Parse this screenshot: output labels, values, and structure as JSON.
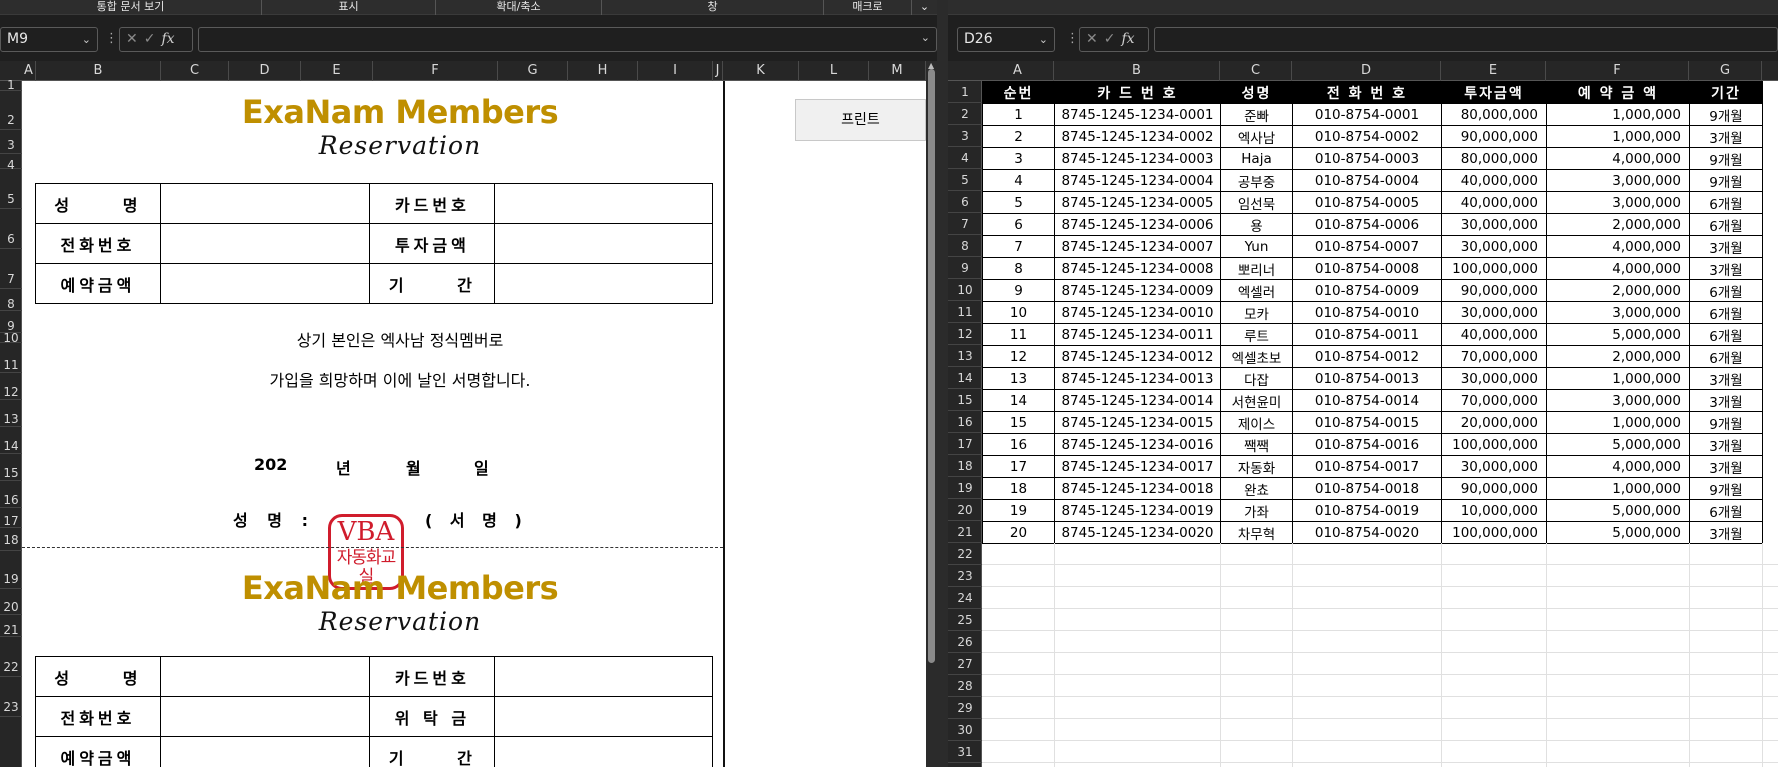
{
  "left": {
    "menu": [
      "통합 문서 보기",
      "표시",
      "확대/축소",
      "창",
      "매크로"
    ],
    "name_box": "M9",
    "columns": [
      "A",
      "B",
      "C",
      "D",
      "E",
      "F",
      "G",
      "H",
      "I",
      "J",
      "K",
      "L",
      "M"
    ],
    "rows": [
      "1",
      "2",
      "3",
      "4",
      "5",
      "6",
      "7",
      "8",
      "9",
      "10",
      "11",
      "12",
      "13",
      "14",
      "15",
      "16",
      "17",
      "18",
      "19",
      "20",
      "21",
      "22",
      "23"
    ],
    "print_button": "프린트",
    "form1": {
      "title": "ExaNam Members",
      "subtitle": "Reservation",
      "labels": {
        "name": "성 명",
        "card": "카드번호",
        "phone": "전화번호",
        "invest": "투자금액",
        "reserve": "예약금액",
        "period": "기 간"
      },
      "statement1": "상기 본인은 엑사남 정식멤버로",
      "statement2": "가입을 희망하며 이에 날인 서명합니다.",
      "date": {
        "year": "202",
        "year_unit": "년",
        "month": "월",
        "day": "일"
      },
      "sign_label": "성 명 :",
      "sign_tail": "( 서 명 )"
    },
    "stamp": {
      "top": "VBA",
      "bottom": "자동화교실"
    },
    "form2": {
      "title": "ExaNam Members",
      "subtitle": "Reservation",
      "labels": {
        "name": "성 명",
        "card": "카드번호",
        "phone": "전화번호",
        "deposit": "위 탁 금",
        "reserve": "예약금액",
        "period": "기 간"
      }
    }
  },
  "right": {
    "name_box": "D26",
    "columns": [
      "A",
      "B",
      "C",
      "D",
      "E",
      "F",
      "G"
    ],
    "headers": [
      "순번",
      "카 드 번 호",
      "성명",
      "전 화 번 호",
      "투자금액",
      "예 약 금 액",
      "기간"
    ],
    "rows": [
      [
        "1",
        "8745-1245-1234-0001",
        "준빠",
        "010-8754-0001",
        "80,000,000",
        "1,000,000",
        "9개월"
      ],
      [
        "2",
        "8745-1245-1234-0002",
        "엑사남",
        "010-8754-0002",
        "90,000,000",
        "1,000,000",
        "3개월"
      ],
      [
        "3",
        "8745-1245-1234-0003",
        "Haja",
        "010-8754-0003",
        "80,000,000",
        "4,000,000",
        "9개월"
      ],
      [
        "4",
        "8745-1245-1234-0004",
        "공부중",
        "010-8754-0004",
        "40,000,000",
        "3,000,000",
        "9개월"
      ],
      [
        "5",
        "8745-1245-1234-0005",
        "임선묵",
        "010-8754-0005",
        "40,000,000",
        "3,000,000",
        "6개월"
      ],
      [
        "6",
        "8745-1245-1234-0006",
        "용",
        "010-8754-0006",
        "30,000,000",
        "2,000,000",
        "6개월"
      ],
      [
        "7",
        "8745-1245-1234-0007",
        "Yun",
        "010-8754-0007",
        "30,000,000",
        "4,000,000",
        "3개월"
      ],
      [
        "8",
        "8745-1245-1234-0008",
        "뽀리너",
        "010-8754-0008",
        "100,000,000",
        "4,000,000",
        "3개월"
      ],
      [
        "9",
        "8745-1245-1234-0009",
        "엑셀러",
        "010-8754-0009",
        "90,000,000",
        "2,000,000",
        "6개월"
      ],
      [
        "10",
        "8745-1245-1234-0010",
        "모카",
        "010-8754-0010",
        "30,000,000",
        "3,000,000",
        "6개월"
      ],
      [
        "11",
        "8745-1245-1234-0011",
        "루트",
        "010-8754-0011",
        "40,000,000",
        "5,000,000",
        "6개월"
      ],
      [
        "12",
        "8745-1245-1234-0012",
        "엑셀초보",
        "010-8754-0012",
        "70,000,000",
        "2,000,000",
        "6개월"
      ],
      [
        "13",
        "8745-1245-1234-0013",
        "다잡",
        "010-8754-0013",
        "30,000,000",
        "1,000,000",
        "3개월"
      ],
      [
        "14",
        "8745-1245-1234-0014",
        "서현윤미",
        "010-8754-0014",
        "70,000,000",
        "3,000,000",
        "3개월"
      ],
      [
        "15",
        "8745-1245-1234-0015",
        "제이스",
        "010-8754-0015",
        "20,000,000",
        "1,000,000",
        "9개월"
      ],
      [
        "16",
        "8745-1245-1234-0016",
        "짹짹",
        "010-8754-0016",
        "100,000,000",
        "5,000,000",
        "3개월"
      ],
      [
        "17",
        "8745-1245-1234-0017",
        "자동화",
        "010-8754-0017",
        "30,000,000",
        "4,000,000",
        "3개월"
      ],
      [
        "18",
        "8745-1245-1234-0018",
        "완쵸",
        "010-8754-0018",
        "90,000,000",
        "1,000,000",
        "9개월"
      ],
      [
        "19",
        "8745-1245-1234-0019",
        "가좌",
        "010-8754-0019",
        "10,000,000",
        "5,000,000",
        "6개월"
      ],
      [
        "20",
        "8745-1245-1234-0020",
        "차무혁",
        "010-8754-0020",
        "100,000,000",
        "5,000,000",
        "3개월"
      ]
    ],
    "row_numbers": [
      "1",
      "2",
      "3",
      "4",
      "5",
      "6",
      "7",
      "8",
      "9",
      "10",
      "11",
      "12",
      "13",
      "14",
      "15",
      "16",
      "17",
      "18",
      "19",
      "20",
      "21",
      "22",
      "23",
      "24",
      "25",
      "26",
      "27",
      "28",
      "29",
      "30",
      "31"
    ]
  }
}
